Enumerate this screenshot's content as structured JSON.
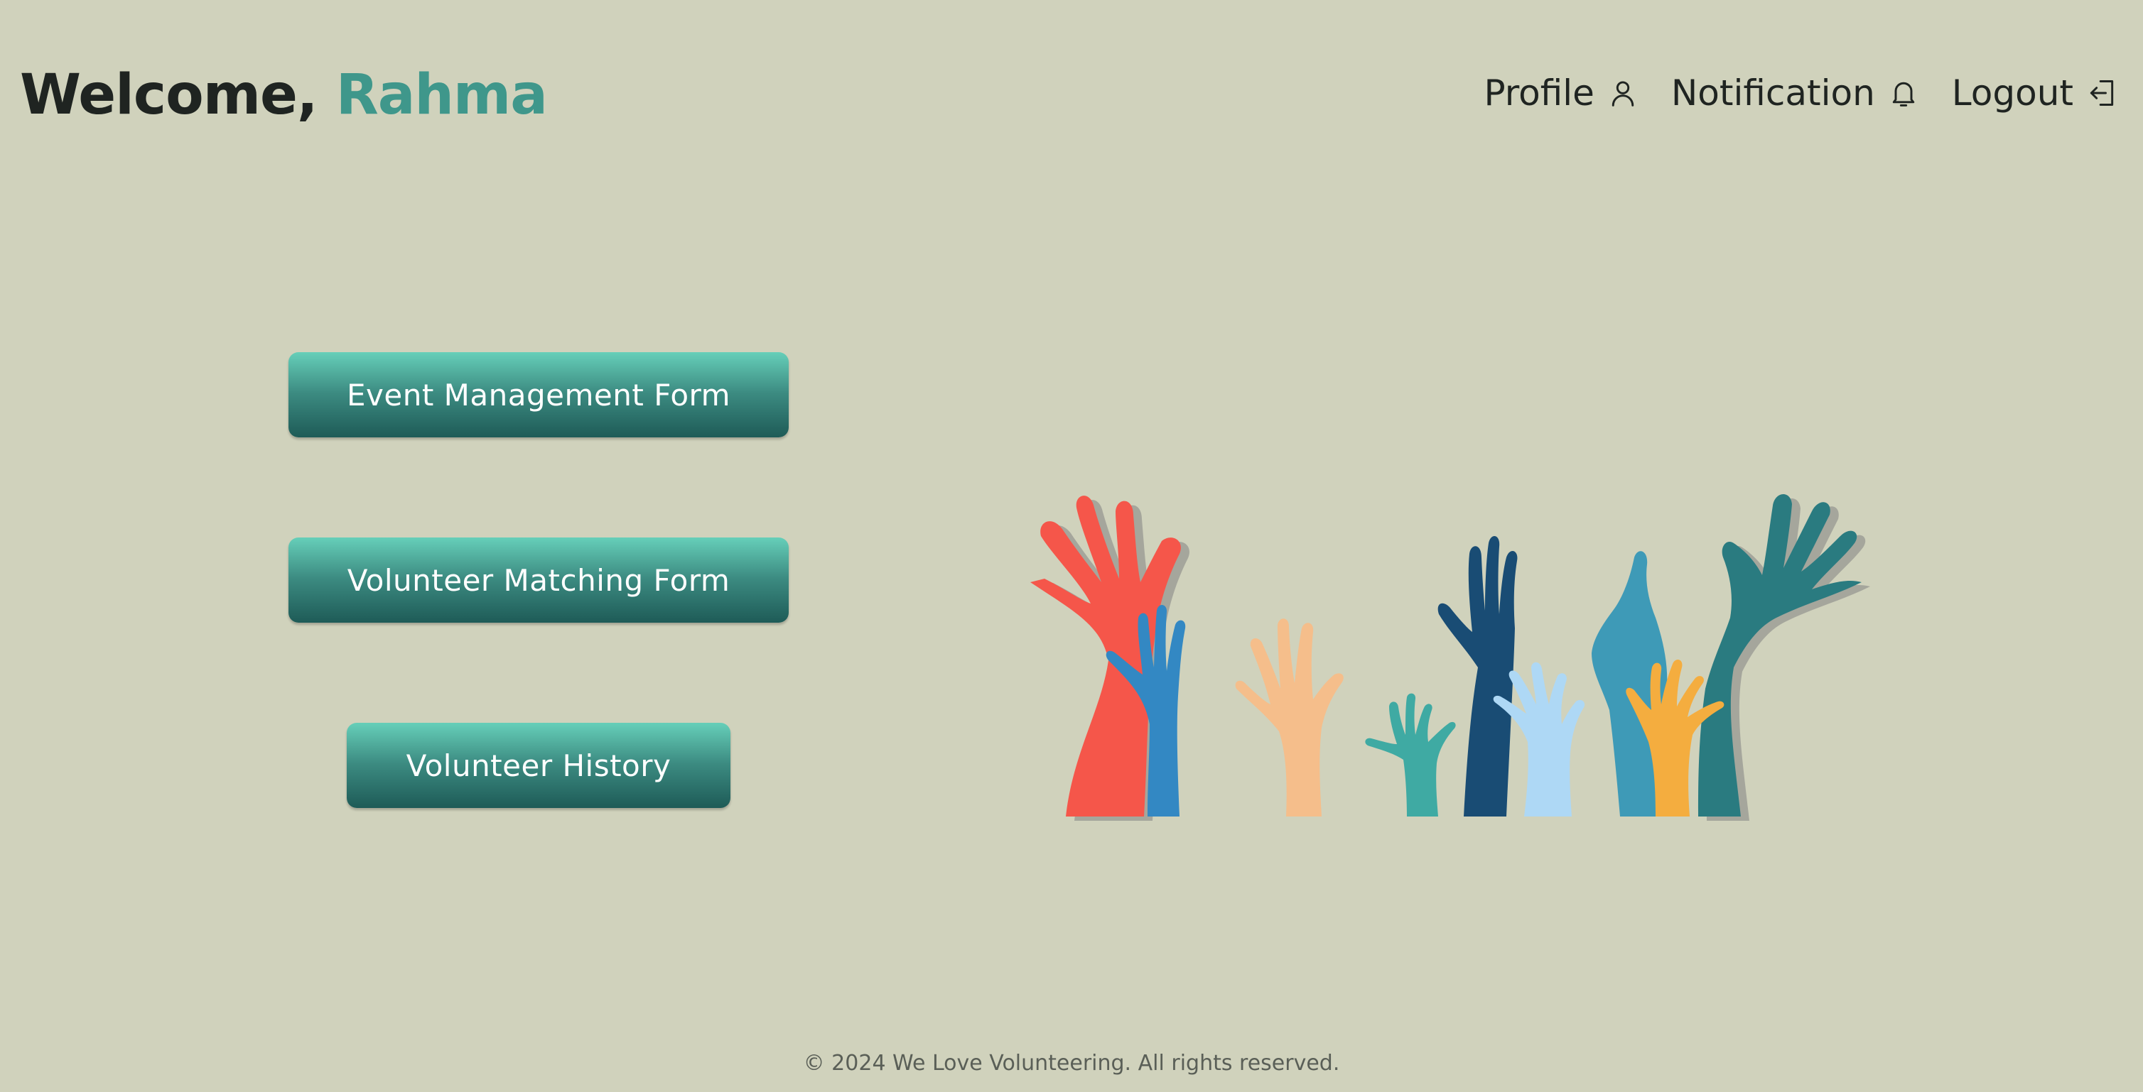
{
  "header": {
    "greeting": "Welcome,",
    "user_name": "Rahma",
    "nav": [
      {
        "label": "Profile",
        "icon": "user-icon"
      },
      {
        "label": "Notification",
        "icon": "bell-icon"
      },
      {
        "label": "Logout",
        "icon": "logout-icon"
      }
    ]
  },
  "actions": {
    "event_management": "Event Management Form",
    "volunteer_matching": "Volunteer Matching Form",
    "volunteer_history": "Volunteer History"
  },
  "illustration": {
    "icon": "raised-hands-illustration",
    "colors": [
      "#f5564a",
      "#3388c3",
      "#f5be8b",
      "#3faaa3",
      "#194c74",
      "#aed8f5",
      "#3e9ab7",
      "#f4ad3f",
      "#2a7b80"
    ]
  },
  "footer": {
    "copyright": "© 2024 We Love Volunteering. All rights reserved."
  },
  "colors": {
    "background": "#d0d2bc",
    "accent": "#3f978b",
    "button_top": "#66cfb9",
    "button_bottom": "#1e5b57"
  }
}
